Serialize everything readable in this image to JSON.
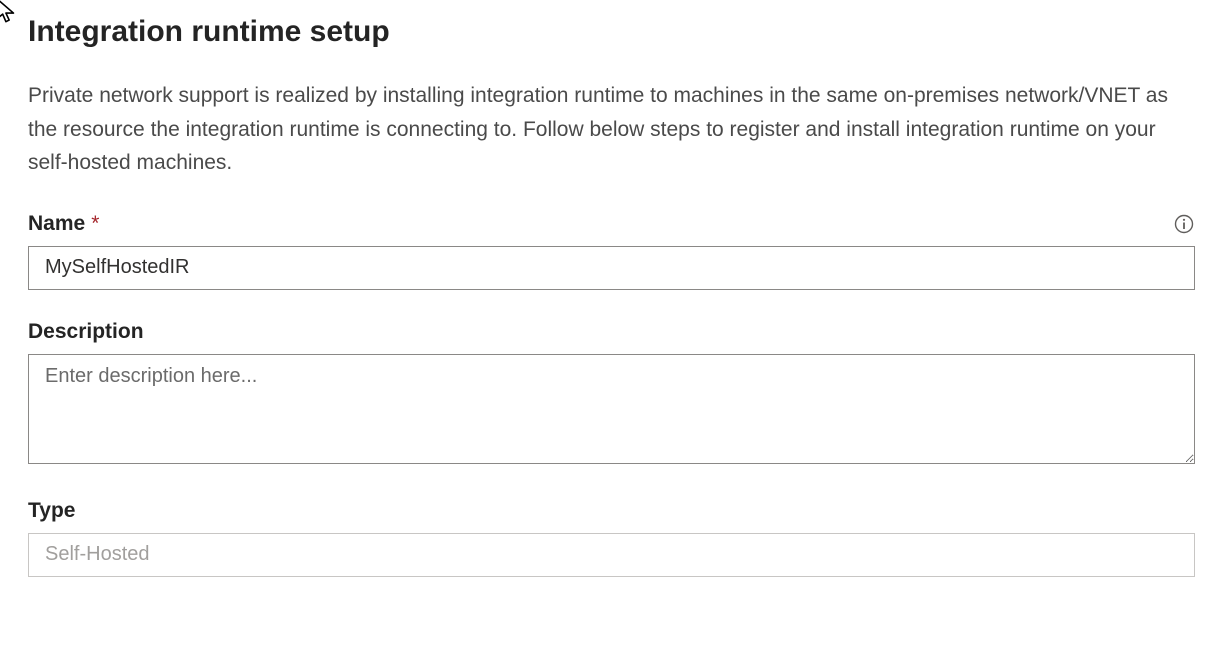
{
  "header": {
    "title": "Integration runtime setup"
  },
  "intro": {
    "text": "Private network support is realized by installing integration runtime to machines in the same on-premises network/VNET as the resource the integration runtime is connecting to. Follow below steps to register and install integration runtime on your self-hosted machines."
  },
  "fields": {
    "name": {
      "label": "Name",
      "required_marker": "*",
      "value": "MySelfHostedIR"
    },
    "description": {
      "label": "Description",
      "placeholder": "Enter description here...",
      "value": ""
    },
    "type": {
      "label": "Type",
      "value": "Self-Hosted"
    }
  }
}
